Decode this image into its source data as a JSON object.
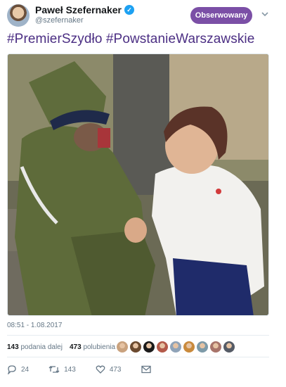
{
  "user": {
    "display_name": "Paweł Szefernaker",
    "handle": "@szefernaker",
    "verified_icon": "verified-badge-icon"
  },
  "follow_button": {
    "label": "Obserwowany",
    "color": "#7b4fa6"
  },
  "tweet": {
    "text": "#PremierSzydło #PowstanieWarszawskie",
    "text_color": "#4b2e83",
    "photo_icon": "attached-photo",
    "timestamp": "08:51 - 1.08.2017"
  },
  "stats": {
    "retweets_count": "143",
    "retweets_label": "podania dalej",
    "likes_count": "473",
    "likes_label": "polubienia"
  },
  "actions": {
    "reply_count": "24",
    "retweet_count": "143",
    "like_count": "473"
  },
  "likers": [
    {
      "name": "liker-avatar-1",
      "color": "#c9a27e"
    },
    {
      "name": "liker-avatar-2",
      "color": "#6b4a2f"
    },
    {
      "name": "liker-avatar-3",
      "color": "#1a1a1a"
    },
    {
      "name": "liker-avatar-4",
      "color": "#b35a4a"
    },
    {
      "name": "liker-avatar-5",
      "color": "#8fa3b8"
    },
    {
      "name": "liker-avatar-6",
      "color": "#c98a3c"
    },
    {
      "name": "liker-avatar-7",
      "color": "#7d9aa8"
    },
    {
      "name": "liker-avatar-8",
      "color": "#a8746a"
    },
    {
      "name": "liker-avatar-9",
      "color": "#555b66"
    }
  ]
}
